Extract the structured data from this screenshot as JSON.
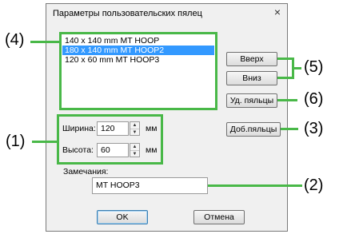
{
  "dialog": {
    "title": "Параметры пользовательских пялец",
    "close_glyph": "×"
  },
  "list": {
    "items": [
      {
        "label": "140 x 140 mm MT HOOP",
        "selected": false
      },
      {
        "label": "180 x 140 mm MT HOOP2",
        "selected": true
      },
      {
        "label": "120 x 60 mm MT HOOP3",
        "selected": false
      }
    ]
  },
  "buttons": {
    "up": "Вверх",
    "down": "Вниз",
    "delete_hoop": "Уд. пяльцы",
    "add_hoop": "Доб.пяльцы",
    "ok": "OK",
    "cancel": "Отмена"
  },
  "fields": {
    "width_label": "Ширина:",
    "width_value": "120",
    "height_label": "Высота:",
    "height_value": "60",
    "unit": "мм",
    "notes_label": "Замечания:",
    "notes_value": "MT HOOP3"
  },
  "callouts": {
    "c1": "(1)",
    "c2": "(2)",
    "c3": "(3)",
    "c4": "(4)",
    "c5": "(5)",
    "c6": "(6)"
  },
  "colors": {
    "highlight": "#49b848",
    "selection": "#3399ff"
  }
}
